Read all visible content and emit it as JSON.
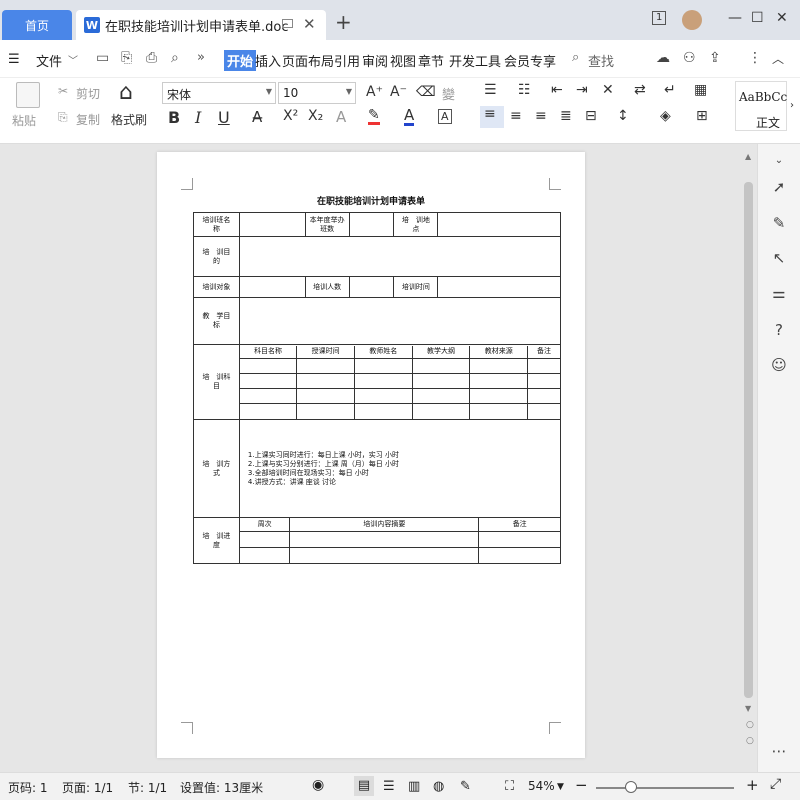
{
  "tabs": {
    "home": "首页",
    "doc_icon": "W",
    "doc_title": "在职技能培训计划申请表单.doc",
    "new_tab": "+"
  },
  "window": {
    "badge": "1",
    "minimize": "—",
    "maximize": "☐",
    "close": "✕"
  },
  "menu": {
    "file": "文件",
    "items": [
      "开始",
      "插入",
      "页面布局",
      "引用",
      "审阅",
      "视图",
      "章节",
      "开发工具",
      "会员专享"
    ],
    "search": "查找"
  },
  "ribbon": {
    "paste": "粘贴",
    "cut": "剪切",
    "copy": "复制",
    "format_painter": "格式刷",
    "font_name": "宋体",
    "font_size": "10",
    "style_preview": "AaBbCc",
    "style_name": "正文"
  },
  "document": {
    "title": "在职技能培训计划申请表单",
    "labels": {
      "class_name": "培训班名　称",
      "annual_count": "本年度举办班数",
      "location": "培　训地　点",
      "purpose": "培　训目　的",
      "target": "培训对象",
      "headcount": "培训人数",
      "time": "培训时间",
      "teaching_goal": "教　学目　标",
      "subjects": "培　训科　目",
      "method": "培　训方　式",
      "progress": "培　训进　度"
    },
    "subject_headers": [
      "科目名称",
      "授课时间",
      "教师姓名",
      "教学大纲",
      "教材来源",
      "备注"
    ],
    "methods": [
      "1.上课实习同时进行：每日上课 小时，实习 小时",
      "2.上课与实习分别进行：上课 周（月）每日 小时",
      "3.全部培训时间在现场实习：每日 小时",
      "4.讲授方式：讲课 座谈 讨论"
    ],
    "progress_headers": [
      "周次",
      "培训内容摘要",
      "备注"
    ]
  },
  "status": {
    "page_no": "页码: 1",
    "pages": "页面: 1/1",
    "section": "节: 1/1",
    "setting": "设置值: 13厘米",
    "zoom": "54%"
  }
}
